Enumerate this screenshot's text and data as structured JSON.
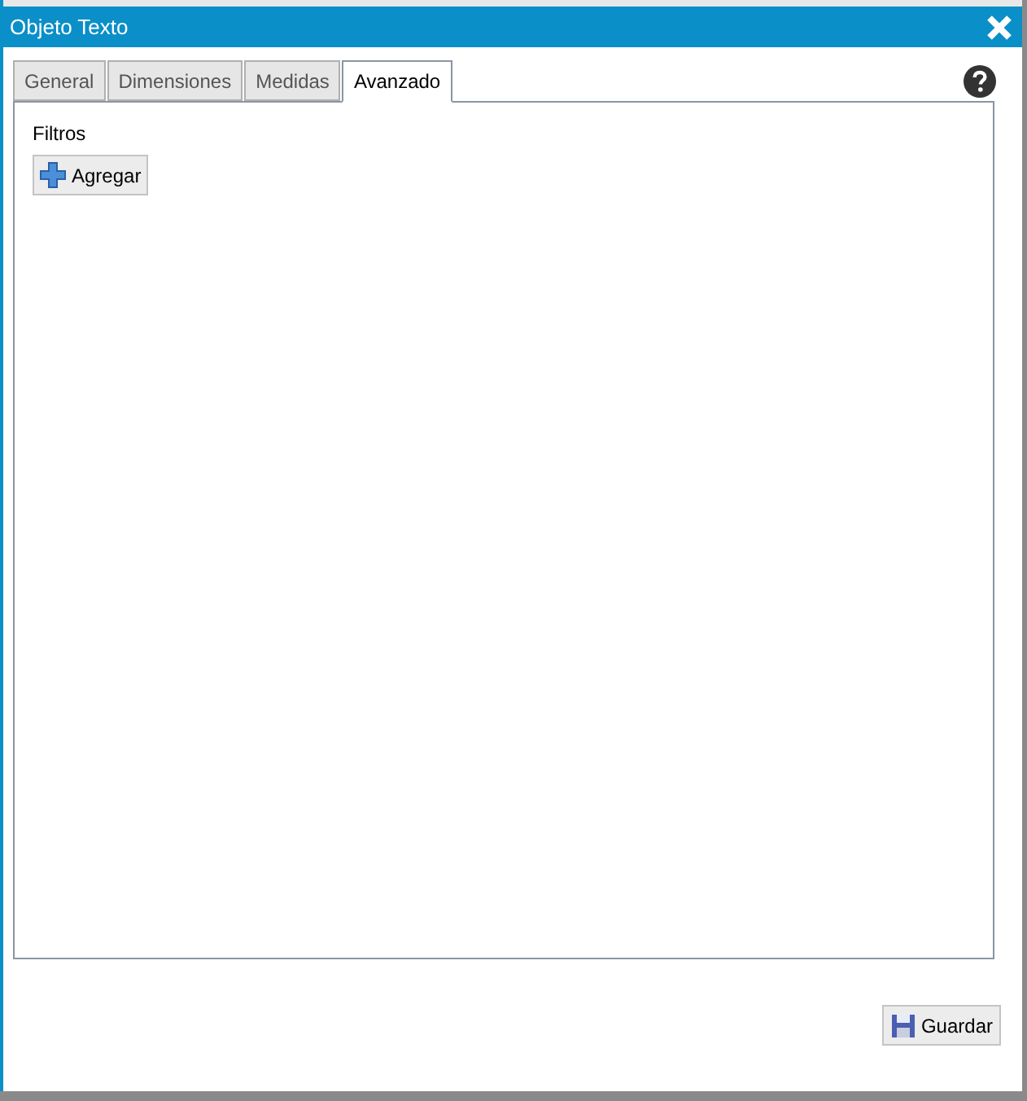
{
  "window": {
    "title": "Objeto Texto"
  },
  "tabs": [
    {
      "label": "General",
      "selected": false
    },
    {
      "label": "Dimensiones",
      "selected": false
    },
    {
      "label": "Medidas",
      "selected": false
    },
    {
      "label": "Avanzado",
      "selected": true
    }
  ],
  "filters": {
    "label": "Filtros",
    "add_button": "Agregar"
  },
  "save_button": "Guardar"
}
